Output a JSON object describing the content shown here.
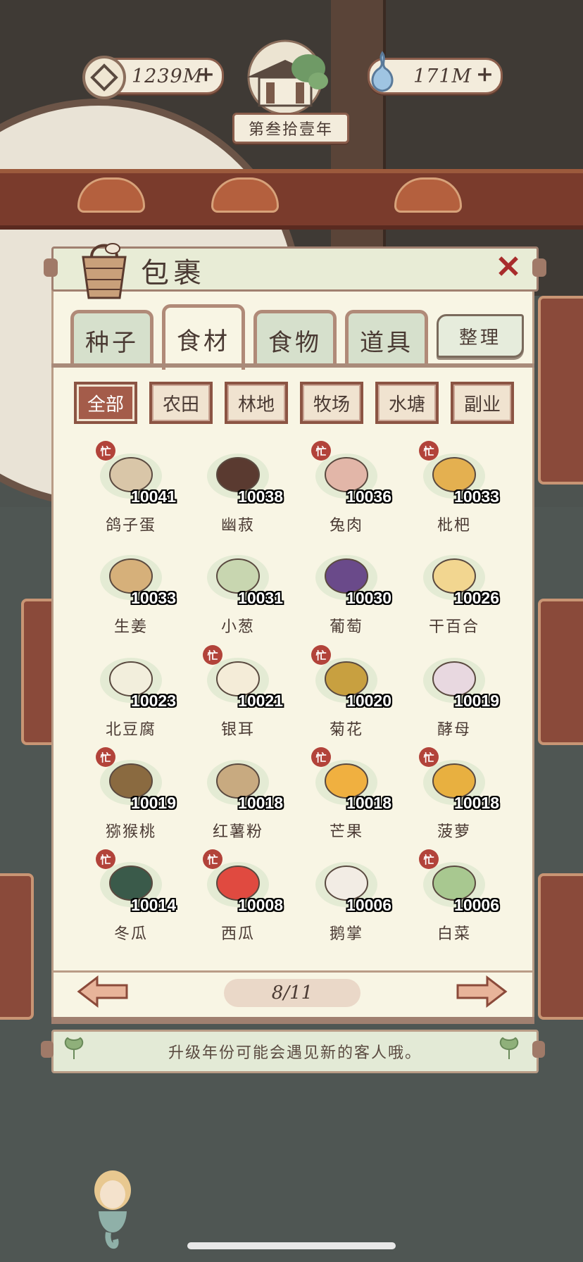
{
  "resources": {
    "coins": {
      "icon": "copper-coin-icon",
      "value": "1239M",
      "plus": "+"
    },
    "water": {
      "icon": "water-gourd-icon",
      "value": "171M",
      "plus": "+"
    }
  },
  "year_label": "第叁拾壹年",
  "panel": {
    "title": "包裹",
    "close": "✕",
    "tabs": [
      {
        "label": "种子",
        "active": false
      },
      {
        "label": "食材",
        "active": true
      },
      {
        "label": "食物",
        "active": false
      },
      {
        "label": "道具",
        "active": false
      }
    ],
    "sort_label": "整理",
    "filters": [
      {
        "label": "全部",
        "active": true
      },
      {
        "label": "农田",
        "active": false
      },
      {
        "label": "林地",
        "active": false
      },
      {
        "label": "牧场",
        "active": false
      },
      {
        "label": "水塘",
        "active": false
      },
      {
        "label": "副业",
        "active": false
      }
    ],
    "stamp_text": "忙",
    "items": [
      {
        "name": "鸽子蛋",
        "count": "10041",
        "icon": "pigeon-egg-icon",
        "stamp": true
      },
      {
        "name": "幽菽",
        "count": "10038",
        "icon": "black-bean-icon",
        "stamp": false
      },
      {
        "name": "兔肉",
        "count": "10036",
        "icon": "rabbit-meat-icon",
        "stamp": true
      },
      {
        "name": "枇杷",
        "count": "10033",
        "icon": "loquat-icon",
        "stamp": true
      },
      {
        "name": "生姜",
        "count": "10033",
        "icon": "ginger-icon",
        "stamp": false
      },
      {
        "name": "小葱",
        "count": "10031",
        "icon": "scallion-icon",
        "stamp": false
      },
      {
        "name": "葡萄",
        "count": "10030",
        "icon": "grape-icon",
        "stamp": false
      },
      {
        "name": "干百合",
        "count": "10026",
        "icon": "dried-lily-icon",
        "stamp": false
      },
      {
        "name": "北豆腐",
        "count": "10023",
        "icon": "tofu-icon",
        "stamp": false
      },
      {
        "name": "银耳",
        "count": "10021",
        "icon": "white-fungus-icon",
        "stamp": true
      },
      {
        "name": "菊花",
        "count": "10020",
        "icon": "chrysanthemum-icon",
        "stamp": true
      },
      {
        "name": "酵母",
        "count": "10019",
        "icon": "yeast-jar-icon",
        "stamp": false
      },
      {
        "name": "猕猴桃",
        "count": "10019",
        "icon": "kiwi-icon",
        "stamp": true
      },
      {
        "name": "红薯粉",
        "count": "10018",
        "icon": "sweet-potato-noodle-icon",
        "stamp": false
      },
      {
        "name": "芒果",
        "count": "10018",
        "icon": "mango-icon",
        "stamp": true
      },
      {
        "name": "菠萝",
        "count": "10018",
        "icon": "pineapple-icon",
        "stamp": true
      },
      {
        "name": "冬瓜",
        "count": "10014",
        "icon": "winter-melon-icon",
        "stamp": true
      },
      {
        "name": "西瓜",
        "count": "10008",
        "icon": "watermelon-icon",
        "stamp": true
      },
      {
        "name": "鹅掌",
        "count": "10006",
        "icon": "goose-feet-icon",
        "stamp": false
      },
      {
        "name": "白菜",
        "count": "10006",
        "icon": "cabbage-icon",
        "stamp": true
      }
    ],
    "page": "8/11"
  },
  "tip": "升级年份可能会遇见新的客人哦。",
  "colors": {
    "accent_red": "#a82c2c",
    "panel_bg": "#f8f5e4",
    "frame_brown": "#8b5443",
    "text": "#4a3a33"
  }
}
